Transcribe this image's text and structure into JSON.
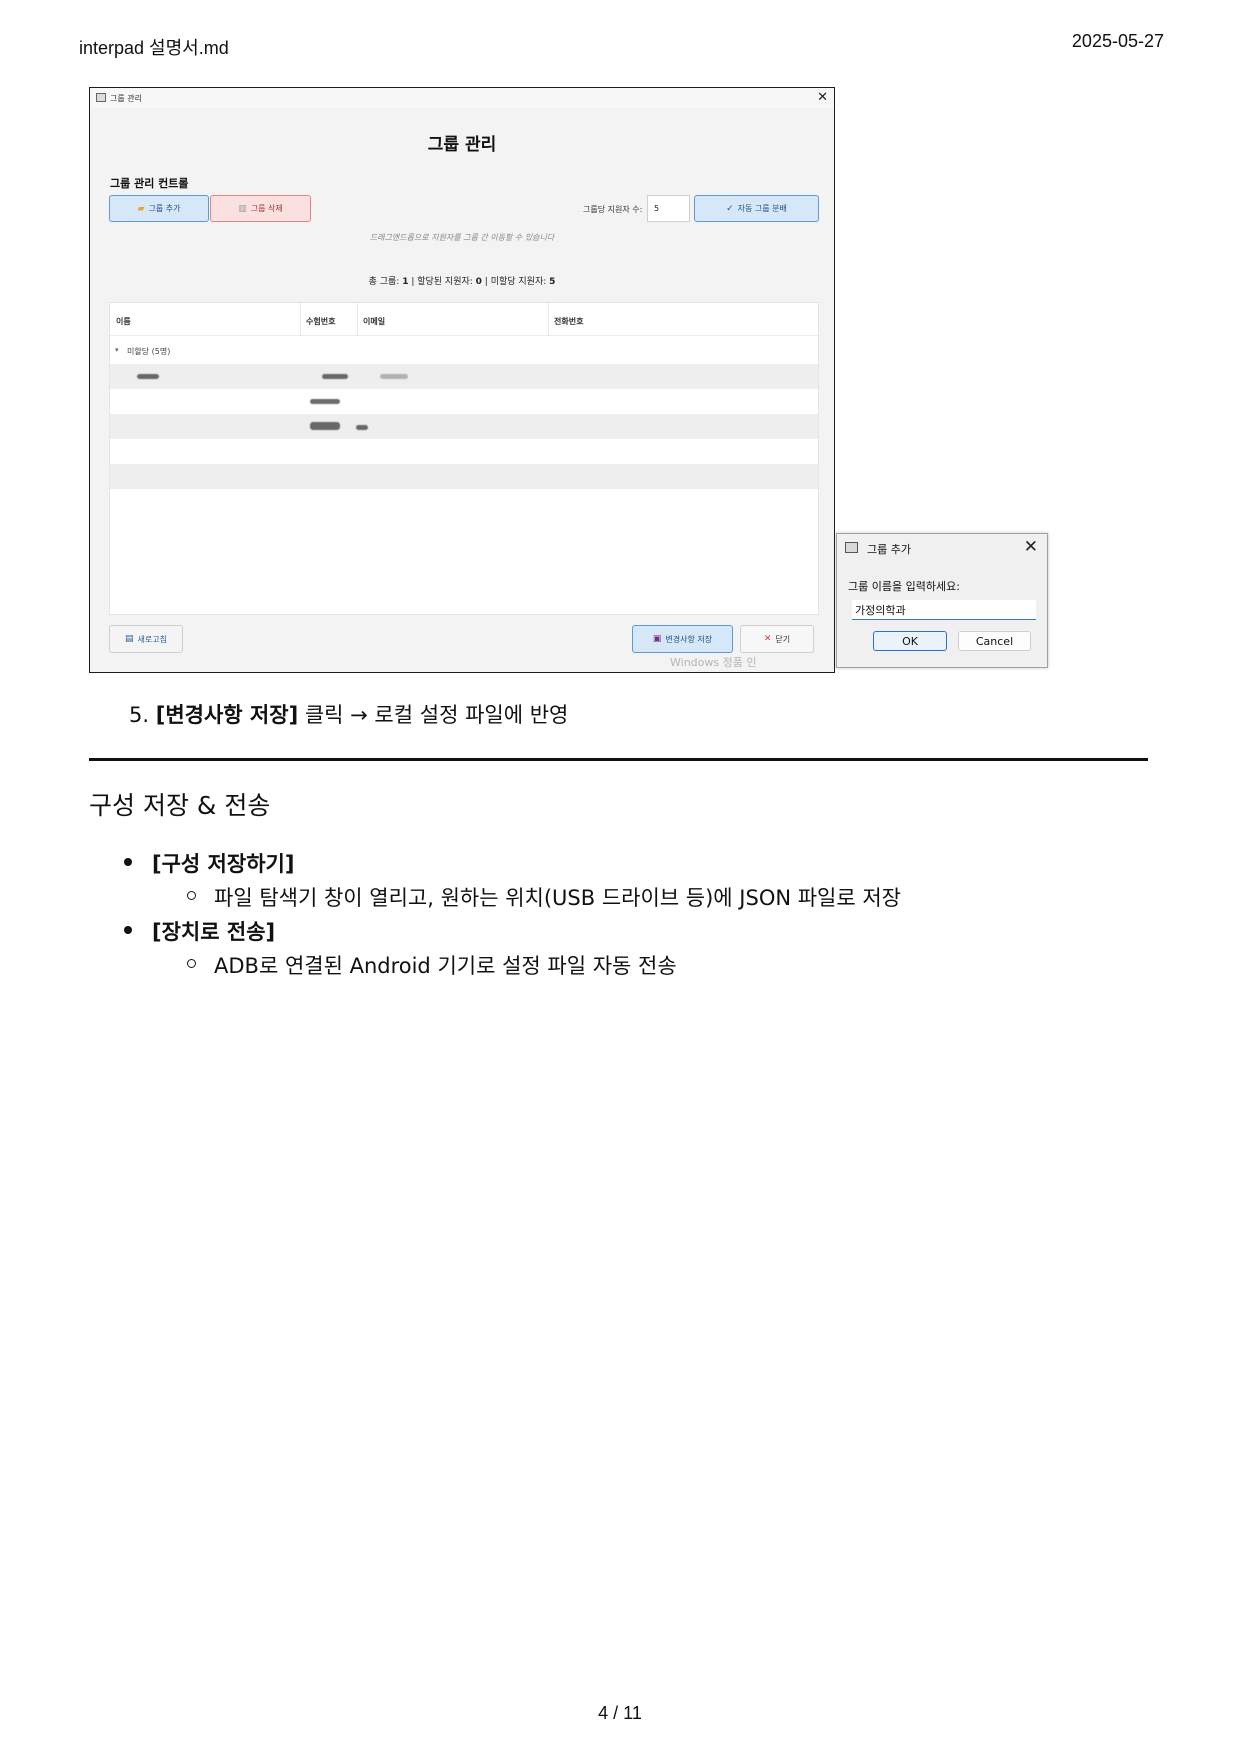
{
  "header": {
    "filename": "interpad 설명서.md",
    "date": "2025-05-27"
  },
  "footer": {
    "page": "4 / 11"
  },
  "window": {
    "title": "그룹 관리",
    "heading": "그룹 관리",
    "control_label": "그룹 관리 컨트롤",
    "add_button": "그룹 추가",
    "delete_button": "그룹 삭제",
    "per_group_label": "그룹당 지원자 수:",
    "per_group_value": "5",
    "auto_button": "자동 그룹 분배",
    "hint": "드래그앤드롭으로 지원자를 그룹 간 이동할 수 있습니다",
    "summary": {
      "prefix": "총 그룹: ",
      "groups": "1",
      "assigned_label": " | 할당된 지원자: ",
      "assigned": "0",
      "unassigned_label": " | 미할당 지원자: ",
      "unassigned": "5"
    },
    "columns": [
      "이름",
      "수험번호",
      "이메일",
      "전화번호"
    ],
    "tree_node": "미할당 (5명)",
    "refresh_button": "새로고침",
    "save_button": "변경사항 저장",
    "close_button": "닫기",
    "watermark": "Windows 정품 인"
  },
  "dialog": {
    "title": "그룹 추가",
    "prompt": "그룹 이름을 입력하세요:",
    "value": "가정의학과",
    "ok": "OK",
    "cancel": "Cancel"
  },
  "doc": {
    "step_number": "5.",
    "step_bold": "[변경사항 저장]",
    "step_text": " 클릭 → 로컬 설정 파일에 반영",
    "section_title": "구성 저장 & 전송",
    "items": [
      {
        "label": "[구성 저장하기]",
        "detail": "파일 탐색기 창이 열리고, 원하는 위치(USB 드라이브 등)에 JSON 파일로 저장"
      },
      {
        "label": "[장치로 전송]",
        "detail": "ADB로 연결된 Android 기기로 설정 파일 자동 전송"
      }
    ]
  }
}
